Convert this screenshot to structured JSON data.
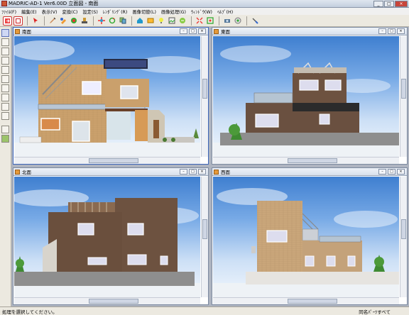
{
  "window": {
    "title": "MADRIC-AD-1 Ver6.00D 立面図 - 南面"
  },
  "menu": {
    "items": [
      {
        "label": "ﾌｧｲﾙ(F)"
      },
      {
        "label": "編集(E)"
      },
      {
        "label": "表示(V)"
      },
      {
        "label": "変換(C)"
      },
      {
        "label": "設定(S)"
      },
      {
        "label": "ﾚﾝﾀﾞﾘﾝｸﾞ(R)"
      },
      {
        "label": "画像切替(L)"
      },
      {
        "label": "画像処理(G)"
      },
      {
        "label": "ｳｨﾝﾄﾞｳ(W)"
      },
      {
        "label": "ﾍﾙﾌﾟ(H)"
      }
    ]
  },
  "panes": {
    "south": {
      "title": "南面"
    },
    "east": {
      "title": "東面"
    },
    "north": {
      "title": "北面"
    },
    "west": {
      "title": "西面"
    }
  },
  "status": {
    "left": "処理を選択してください。",
    "right": "同名ﾊﾟｰﾂすべて"
  },
  "icons": {
    "toolbar": [
      "exit-icon",
      "new-icon",
      "pointer-icon",
      "pen-icon",
      "paint-icon",
      "color-icon",
      "stamp-icon",
      "move-icon",
      "rotate-icon",
      "copy-icon",
      "house-icon",
      "render-icon",
      "light-icon",
      "image-icon",
      "export-icon",
      "zoom-icon",
      "fit-icon",
      "camera-icon",
      "help-icon"
    ]
  }
}
